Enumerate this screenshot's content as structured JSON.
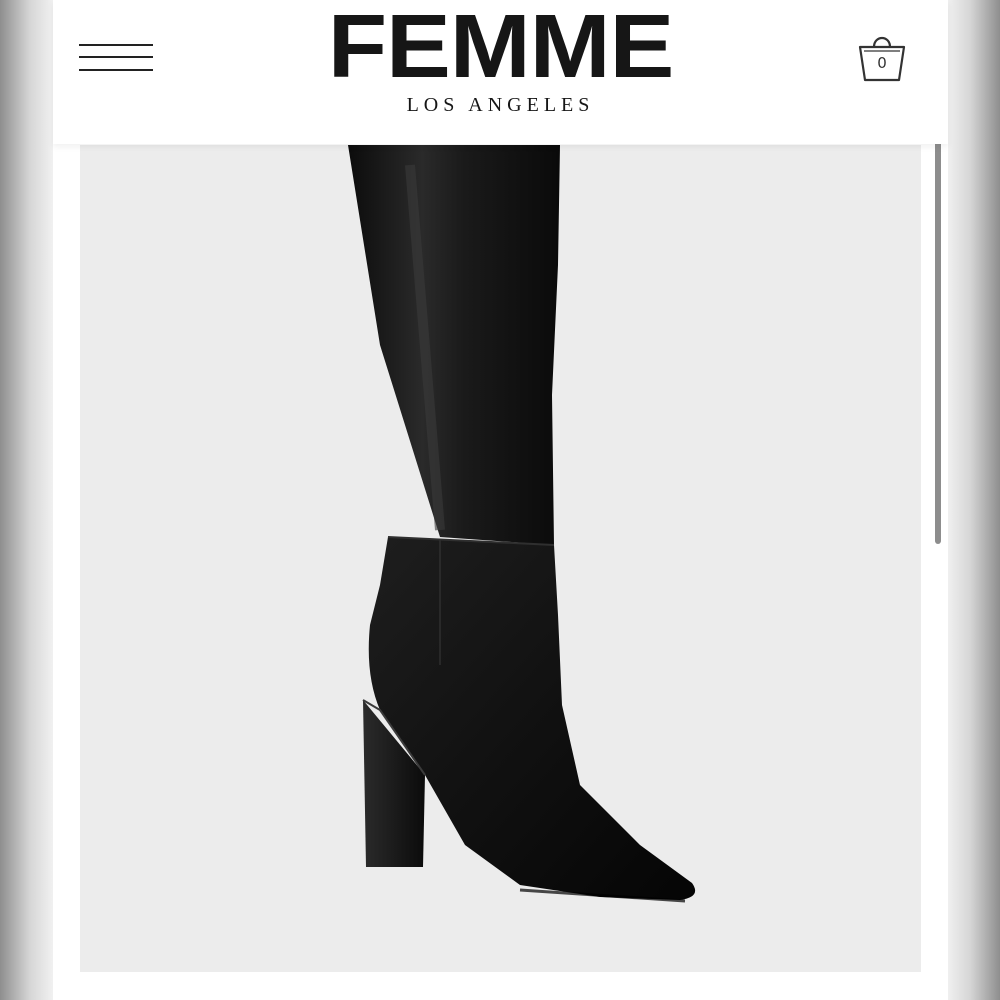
{
  "header": {
    "menu_icon": "hamburger-menu-icon",
    "brand_name": "FEMME",
    "brand_sub": "LOS ANGELES",
    "cart": {
      "icon": "shopping-bag-icon",
      "count": "0"
    }
  },
  "product": {
    "image_icon": "black-knee-high-boot-image"
  },
  "colors": {
    "background": "#ffffff",
    "text": "#161616",
    "image_bg": "#ececec",
    "boot": "#141414"
  }
}
